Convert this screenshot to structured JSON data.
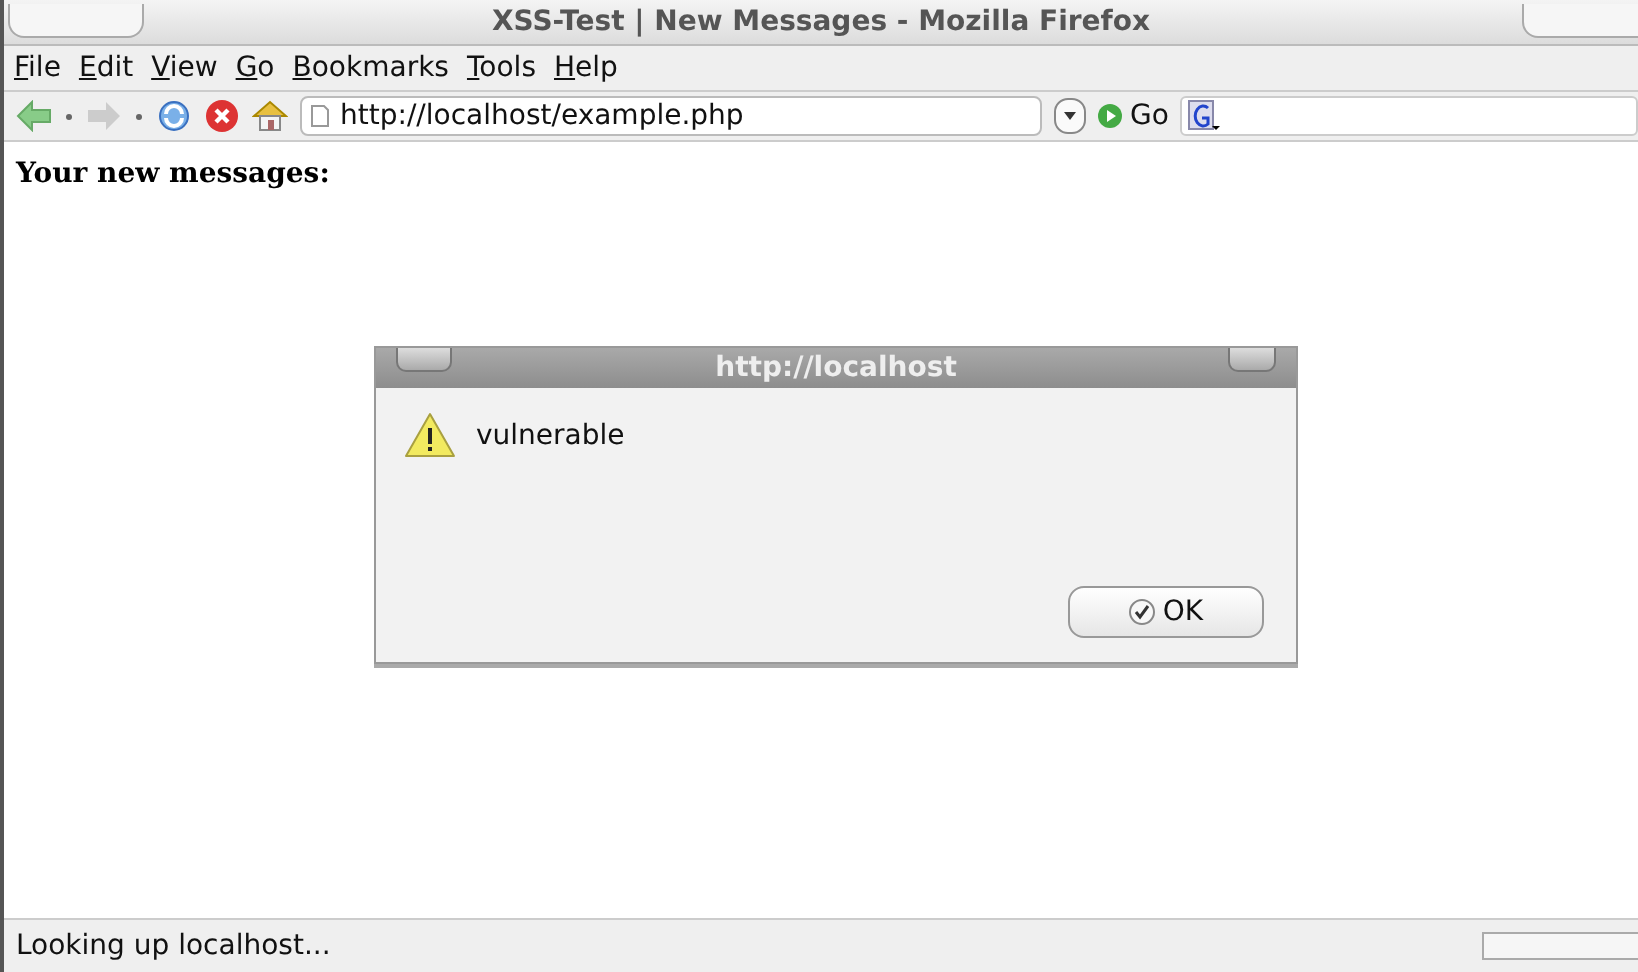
{
  "window": {
    "title": "XSS-Test | New Messages - Mozilla Firefox"
  },
  "menu": [
    "File",
    "Edit",
    "View",
    "Go",
    "Bookmarks",
    "Tools",
    "Help"
  ],
  "toolbar": {
    "url": "http://localhost/example.php",
    "go_label": "Go"
  },
  "page": {
    "heading": "Your new messages:"
  },
  "dialog": {
    "title": "http://localhost",
    "message": "vulnerable",
    "button": "OK"
  },
  "status_bar": {
    "text": "Looking up localhost...",
    "progress": {
      "level": 0
    }
  }
}
